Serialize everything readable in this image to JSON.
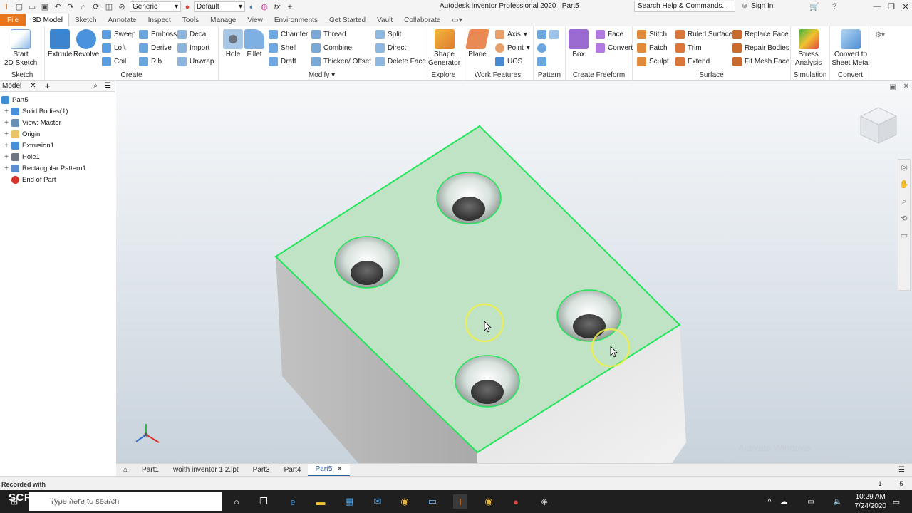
{
  "titlebar": {
    "appearance": "Generic",
    "style": "Default",
    "title": "Autodesk Inventor Professional 2020",
    "document": "Part5",
    "search_placeholder": "Search Help & Commands...",
    "signin": "Sign In"
  },
  "tabs": [
    "File",
    "3D Model",
    "Sketch",
    "Annotate",
    "Inspect",
    "Tools",
    "Manage",
    "View",
    "Environments",
    "Get Started",
    "Vault",
    "Collaborate"
  ],
  "ribbon": {
    "sketch": {
      "start_l1": "Start",
      "start_l2": "2D Sketch",
      "label": "Sketch"
    },
    "create": {
      "extrude": "Extrude",
      "revolve": "Revolve",
      "sweep": "Sweep",
      "loft": "Loft",
      "coil": "Coil",
      "emboss": "Emboss",
      "derive": "Derive",
      "rib": "Rib",
      "decal": "Decal",
      "import": "Import",
      "unwrap": "Unwrap",
      "label": "Create"
    },
    "modify": {
      "hole": "Hole",
      "fillet": "Fillet",
      "chamfer": "Chamfer",
      "shell": "Shell",
      "draft": "Draft",
      "thread": "Thread",
      "combine": "Combine",
      "thicken": "Thicken/ Offset",
      "split": "Split",
      "direct": "Direct",
      "delete_face": "Delete Face",
      "label": "Modify"
    },
    "explore": {
      "shape_l1": "Shape",
      "shape_l2": "Generator",
      "label": "Explore"
    },
    "work": {
      "plane": "Plane",
      "axis": "Axis",
      "point": "Point",
      "ucs": "UCS",
      "label": "Work Features"
    },
    "pattern": {
      "label": "Pattern"
    },
    "freeform": {
      "box": "Box",
      "face": "Face",
      "convert": "Convert",
      "label": "Create Freeform"
    },
    "surface": {
      "stitch": "Stitch",
      "patch": "Patch",
      "sculpt": "Sculpt",
      "ruled": "Ruled Surface",
      "trim": "Trim",
      "extend": "Extend",
      "replace": "Replace Face",
      "repair": "Repair Bodies",
      "fitmesh": "Fit Mesh Face",
      "label": "Surface"
    },
    "simulation": {
      "l1": "Stress",
      "l2": "Analysis",
      "label": "Simulation"
    },
    "convert": {
      "l1": "Convert to",
      "l2": "Sheet Metal",
      "label": "Convert"
    }
  },
  "browser": {
    "tab": "Model",
    "items": [
      {
        "label": "Part5",
        "expander": "",
        "icon": "#3d8ed6"
      },
      {
        "label": "Solid Bodies(1)",
        "expander": "+",
        "icon": "#4a90d9"
      },
      {
        "label": "View: Master",
        "expander": "+",
        "icon": "#6a8fb5"
      },
      {
        "label": "Origin",
        "expander": "+",
        "icon": "#e9c46a"
      },
      {
        "label": "Extrusion1",
        "expander": "+",
        "icon": "#4a8fd6"
      },
      {
        "label": "Hole1",
        "expander": "+",
        "icon": "#6e7780"
      },
      {
        "label": "Rectangular Pattern1",
        "expander": "+",
        "icon": "#5b8ccc"
      },
      {
        "label": "End of Part",
        "expander": "",
        "icon": "#d9342b"
      }
    ]
  },
  "viewport": {
    "watermark_l1": "Activate Windows",
    "watermark_l2": "Go to Settings to activate Windows.",
    "selection_color": "#22e65a",
    "face_color": "#bfe3c4"
  },
  "doctabs": [
    "Part1",
    "woith inventor 1.2.ipt",
    "Part3",
    "Part4",
    "Part5"
  ],
  "status": {
    "left": "Recorded with",
    "count1": "1",
    "count2": "5"
  },
  "taskbar": {
    "search_placeholder": "Type here to search",
    "time": "10:29 AM",
    "date": "7/24/2020",
    "brand": "SCREENCAST-O-MATIC"
  }
}
